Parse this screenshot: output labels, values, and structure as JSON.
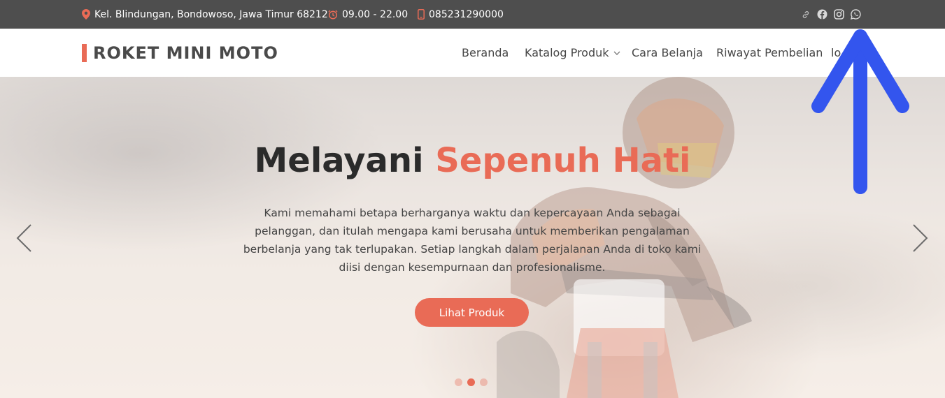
{
  "topbar": {
    "address": "Kel. Blindungan, Bondowoso, Jawa Timur 68212",
    "hours": "09.00 - 22.00",
    "phone": "085231290000",
    "social_icons": [
      "link-icon",
      "facebook-icon",
      "instagram-icon",
      "whatsapp-icon"
    ]
  },
  "header": {
    "brand": "ROKET MINI MOTO",
    "nav": [
      {
        "label": "Beranda"
      },
      {
        "label": "Katalog Produk"
      },
      {
        "label": "Cara Belanja"
      },
      {
        "label": "Riwayat Pembelian"
      },
      {
        "label": "lo"
      }
    ]
  },
  "hero": {
    "title_part1": "Melayani ",
    "title_part2": "Sepenuh Hati",
    "description": "Kami memahami betapa berharganya waktu dan kepercayaan Anda sebagai pelanggan, dan itulah mengapa kami berusaha untuk memberikan pengalaman berbelanja yang tak terlupakan. Setiap langkah dalam perjalanan Anda di toko kami diisi dengan kesempurnaan dan profesionalisme.",
    "button": "Lihat Produk",
    "slides_total": 3,
    "active_slide": 2
  },
  "colors": {
    "accent": "#e96b56",
    "topbar_bg": "#4e4e4e",
    "annotation_arrow": "#3355ee"
  }
}
